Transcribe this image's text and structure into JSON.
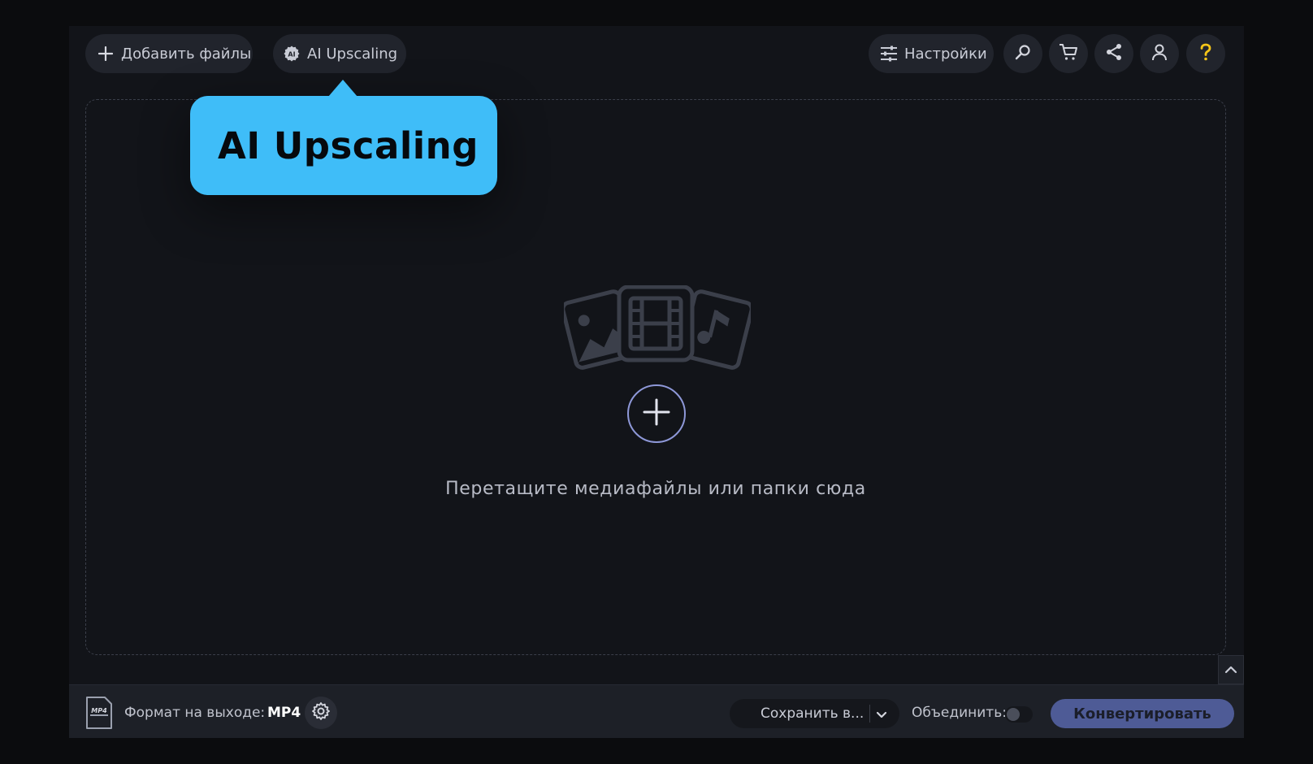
{
  "toolbar": {
    "add_files_label": "Добавить файлы",
    "ai_upscaling_label": "AI Upscaling",
    "settings_label": "Настройки"
  },
  "tooltip": {
    "text": "AI Upscaling"
  },
  "dropzone": {
    "text": "Перетащите медиафайлы или папки сюда"
  },
  "bottom": {
    "format_label": "Формат на выходе:",
    "format_value": "MP4",
    "format_icon_text": "MP4",
    "save_label": "Сохранить в...",
    "merge_label": "Объединить:",
    "convert_label": "Конвертировать"
  },
  "colors": {
    "tooltip_bg": "#3fbdf8",
    "help_icon": "#f5c518",
    "convert_bg": "#4e5b96",
    "plus_ring": "#8e98d8"
  }
}
